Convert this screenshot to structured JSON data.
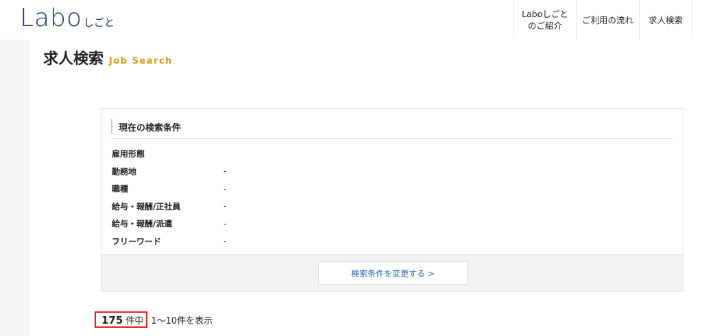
{
  "header": {
    "logo_main": "Labo",
    "logo_sub": "しごと",
    "nav": {
      "about_line1": "Laboしごと",
      "about_line2": "のご紹介",
      "flow": "ご利用の流れ",
      "search": "求人検索"
    }
  },
  "page": {
    "title_jp": "求人検索",
    "title_en": "Job Search"
  },
  "conditions": {
    "heading": "現在の検索条件",
    "rows": [
      {
        "label": "雇用形態",
        "value": ""
      },
      {
        "label": "勤務地",
        "value": "-"
      },
      {
        "label": "職種",
        "value": "-"
      },
      {
        "label": "給与・報酬/正社員",
        "value": "-"
      },
      {
        "label": "給与・報酬/派遣",
        "value": "-"
      },
      {
        "label": "フリーワード",
        "value": "-"
      }
    ],
    "change_button": "検索条件を変更する >"
  },
  "results": {
    "count": "175",
    "unit": "件中",
    "range": "1〜10件を表示"
  },
  "colors": {
    "logo": "#1b3a66",
    "title_accent": "#d89a1a",
    "link": "#2a67b8",
    "highlight_border": "#e0201b"
  }
}
